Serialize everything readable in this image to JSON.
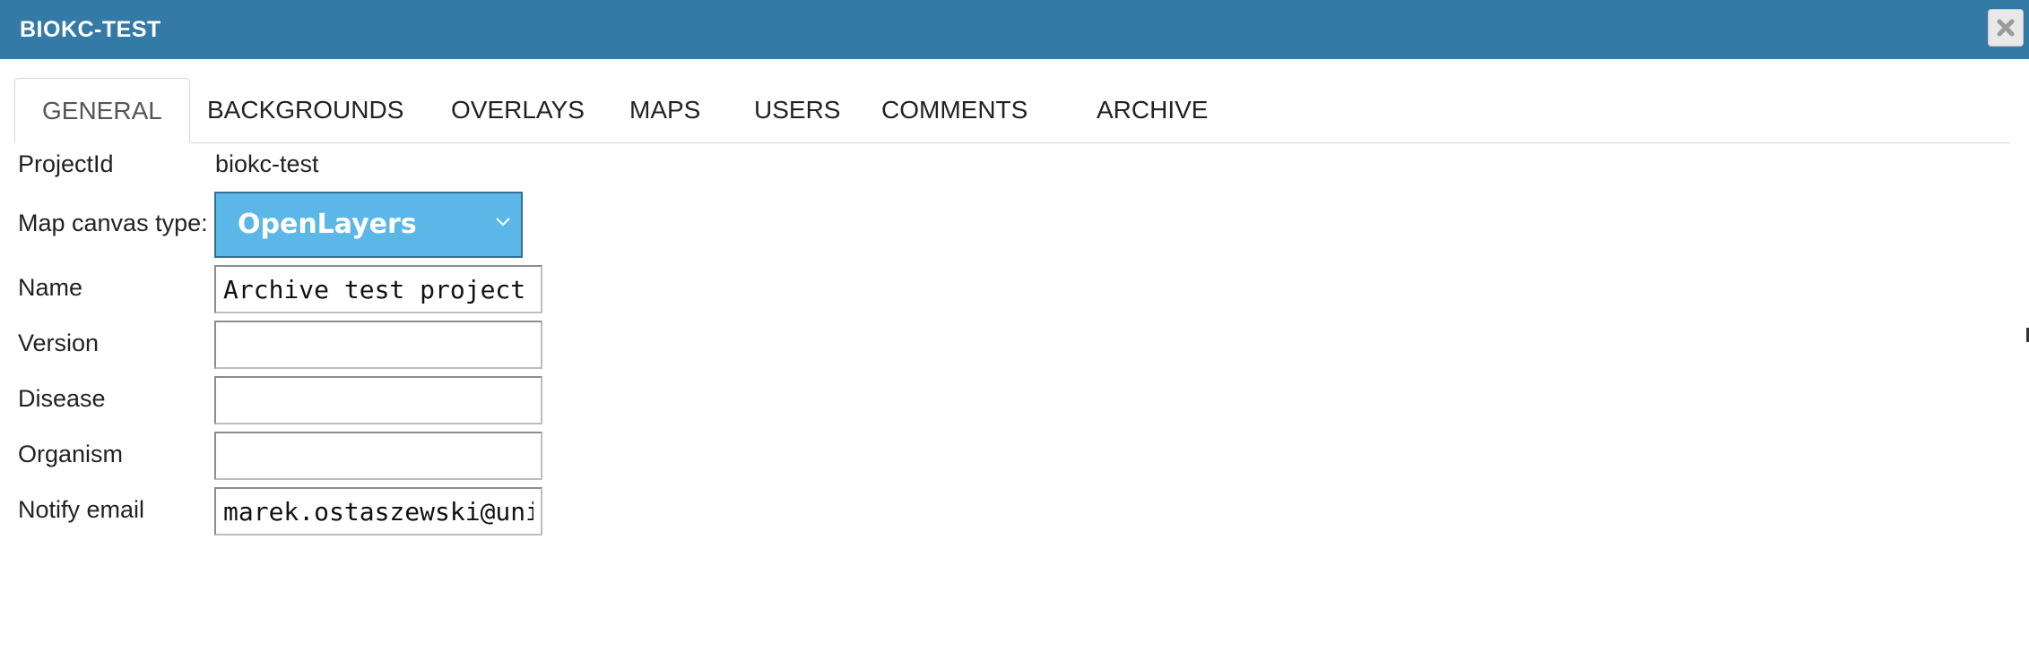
{
  "window": {
    "title": "BIOKC-TEST",
    "close_icon": "close-icon"
  },
  "tabs": [
    {
      "label": "GENERAL",
      "active": true
    },
    {
      "label": "BACKGROUNDS",
      "active": false
    },
    {
      "label": "OVERLAYS",
      "active": false
    },
    {
      "label": "MAPS",
      "active": false
    },
    {
      "label": "USERS",
      "active": false
    },
    {
      "label": "COMMENTS",
      "active": false
    },
    {
      "label": "ARCHIVE",
      "active": false
    }
  ],
  "form": {
    "project_id": {
      "label": "ProjectId",
      "value": "biokc-test"
    },
    "map_canvas": {
      "label": "Map canvas type:",
      "selected": "OpenLayers"
    },
    "name": {
      "label": "Name",
      "value": "Archive test project"
    },
    "version": {
      "label": "Version",
      "value": ""
    },
    "disease": {
      "label": "Disease",
      "value": ""
    },
    "organism": {
      "label": "Organism",
      "value": ""
    },
    "notify_email": {
      "label": "Notify email",
      "value": "marek.ostaszewski@uni.lu"
    }
  },
  "colors": {
    "titlebar": "#347aa7",
    "select_bg": "#5bb7e8"
  }
}
